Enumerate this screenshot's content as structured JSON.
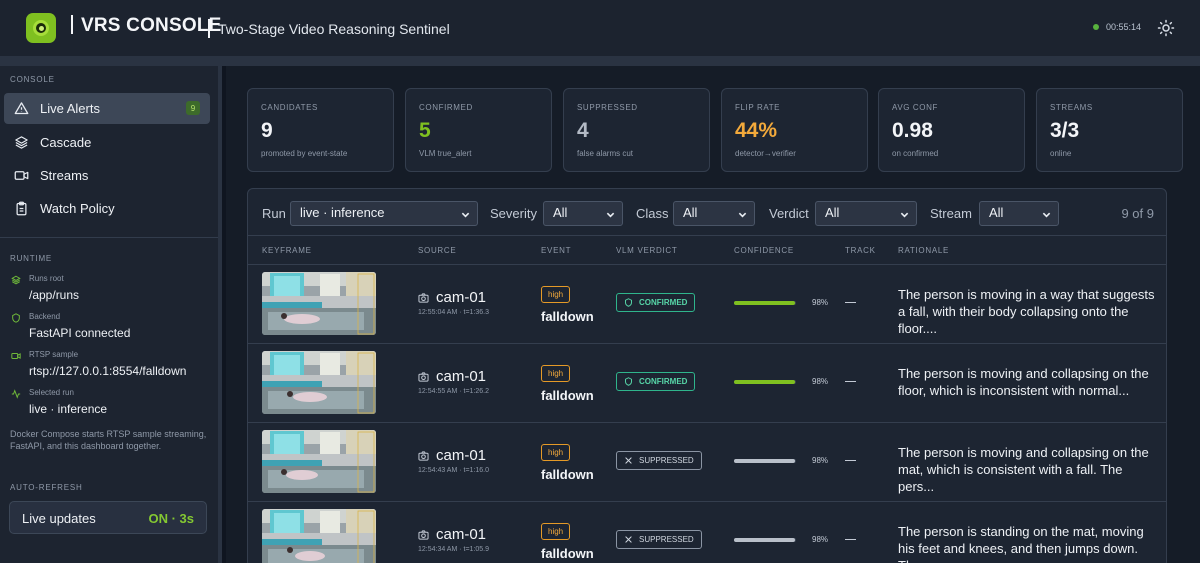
{
  "header": {
    "title": "VRS CONSOLE",
    "subtitle": "Two-Stage Video Reasoning Sentinel",
    "clock": "00:55:14"
  },
  "colors": {
    "accent": "#7fc020",
    "confirmed": "#2fb58c",
    "warning": "#e59a27"
  },
  "sidebar": {
    "console_label": "CONSOLE",
    "nav": [
      {
        "label": "Live Alerts",
        "icon": "alert-triangle-icon",
        "badge": "9"
      },
      {
        "label": "Cascade",
        "icon": "layers-icon"
      },
      {
        "label": "Streams",
        "icon": "video-camera-icon"
      },
      {
        "label": "Watch Policy",
        "icon": "clipboard-icon"
      }
    ],
    "runtime_label": "RUNTIME",
    "runtime": [
      {
        "key": "Runs root",
        "value": "/app/runs",
        "icon": "layers-icon"
      },
      {
        "key": "Backend",
        "value": "FastAPI connected",
        "icon": "shield-icon"
      },
      {
        "key": "RTSP sample",
        "value": "rtsp://127.0.0.1:8554/falldown",
        "icon": "video-camera-icon"
      },
      {
        "key": "Selected run",
        "value": "live · inference",
        "icon": "activity-icon"
      }
    ],
    "note": "Docker Compose starts RTSP sample streaming, FastAPI, and this dashboard together.",
    "autorefresh_label": "AUTO-REFRESH",
    "refresh": {
      "label": "Live updates",
      "state": "ON · 3s"
    }
  },
  "stats": [
    {
      "key": "CANDIDATES",
      "value": "9",
      "sub": "promoted by event-state",
      "color": "#f3f5f8"
    },
    {
      "key": "CONFIRMED",
      "value": "5",
      "sub": "VLM true_alert",
      "color": "#7fc020"
    },
    {
      "key": "SUPPRESSED",
      "value": "4",
      "sub": "false alarms cut",
      "color": "#b3bac5"
    },
    {
      "key": "FLIP RATE",
      "value": "44%",
      "sub": "detector→verifier",
      "color": "#f2a93b"
    },
    {
      "key": "AVG CONF",
      "value": "0.98",
      "sub": "on confirmed",
      "color": "#f3f5f8"
    },
    {
      "key": "STREAMS",
      "value": "3/3",
      "sub": "online",
      "color": "#f3f5f8"
    }
  ],
  "filters": {
    "run_label": "Run",
    "run_value": "live · inference",
    "severity_label": "Severity",
    "severity_value": "All",
    "class_label": "Class",
    "class_value": "All",
    "verdict_label": "Verdict",
    "verdict_value": "All",
    "stream_label": "Stream",
    "stream_value": "All",
    "count": "9 of 9"
  },
  "table": {
    "columns": [
      "KEYFRAME",
      "SOURCE",
      "EVENT",
      "VLM VERDICT",
      "CONFIDENCE",
      "TRACK",
      "RATIONALE"
    ],
    "rows": [
      {
        "source": "cam-01",
        "time": "12:55:04 AM · t=1:36.3",
        "severity": "high",
        "event": "falldown",
        "verdict": "CONFIRMED",
        "verdict_type": "confirmed",
        "confidence": 0.98,
        "confidence_text": "98%",
        "track": "—",
        "rationale": "The person is moving in a way that suggests a fall, with their body collapsing onto the floor...."
      },
      {
        "source": "cam-01",
        "time": "12:54:55 AM · t=1:26.2",
        "severity": "high",
        "event": "falldown",
        "verdict": "CONFIRMED",
        "verdict_type": "confirmed",
        "confidence": 0.98,
        "confidence_text": "98%",
        "track": "—",
        "rationale": "The person is moving and collapsing on the floor, which is inconsistent with normal..."
      },
      {
        "source": "cam-01",
        "time": "12:54:43 AM · t=1:16.0",
        "severity": "high",
        "event": "falldown",
        "verdict": "SUPPRESSED",
        "verdict_type": "suppressed",
        "confidence": 0.98,
        "confidence_text": "98%",
        "track": "—",
        "rationale": "The person is moving and collapsing on the mat, which is consistent with a fall. The pers..."
      },
      {
        "source": "cam-01",
        "time": "12:54:34 AM · t=1:05.9",
        "severity": "high",
        "event": "falldown",
        "verdict": "SUPPRESSED",
        "verdict_type": "suppressed",
        "confidence": 0.98,
        "confidence_text": "98%",
        "track": "—",
        "rationale": "The person is standing on the mat, moving his feet and knees, and then jumps down. The..."
      }
    ]
  }
}
